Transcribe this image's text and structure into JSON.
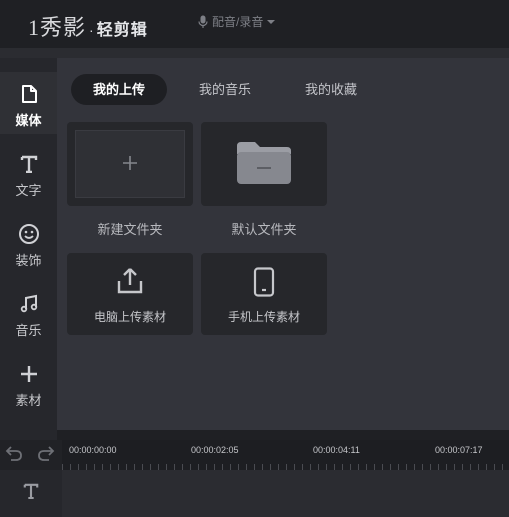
{
  "header": {
    "logo_main": "1秀影",
    "logo_dot": "·",
    "logo_sub": "轻剪辑",
    "mic_label": "配音/录音"
  },
  "sidebar": {
    "items": [
      {
        "label": "媒体",
        "icon": "media-file-icon"
      },
      {
        "label": "文字",
        "icon": "text-icon"
      },
      {
        "label": "装饰",
        "icon": "smiley-icon"
      },
      {
        "label": "音乐",
        "icon": "music-note-icon"
      },
      {
        "label": "素材",
        "icon": "plus-icon"
      }
    ],
    "active_index": 0
  },
  "tabs": [
    {
      "label": "我的上传"
    },
    {
      "label": "我的音乐"
    },
    {
      "label": "我的收藏"
    }
  ],
  "grid": {
    "new_folder_label": "新建文件夹",
    "default_folder_label": "默认文件夹",
    "pc_upload_label": "电脑上传素材",
    "phone_upload_label": "手机上传素材"
  },
  "timeline": {
    "ticks": [
      "00:00:00:00",
      "00:00:02:05",
      "00:00:04:11",
      "00:00:07:17"
    ]
  },
  "colors": {
    "background": "#1f2024",
    "panel": "#33343b",
    "tile": "#26272b",
    "active_tab": "#1e1f23"
  }
}
